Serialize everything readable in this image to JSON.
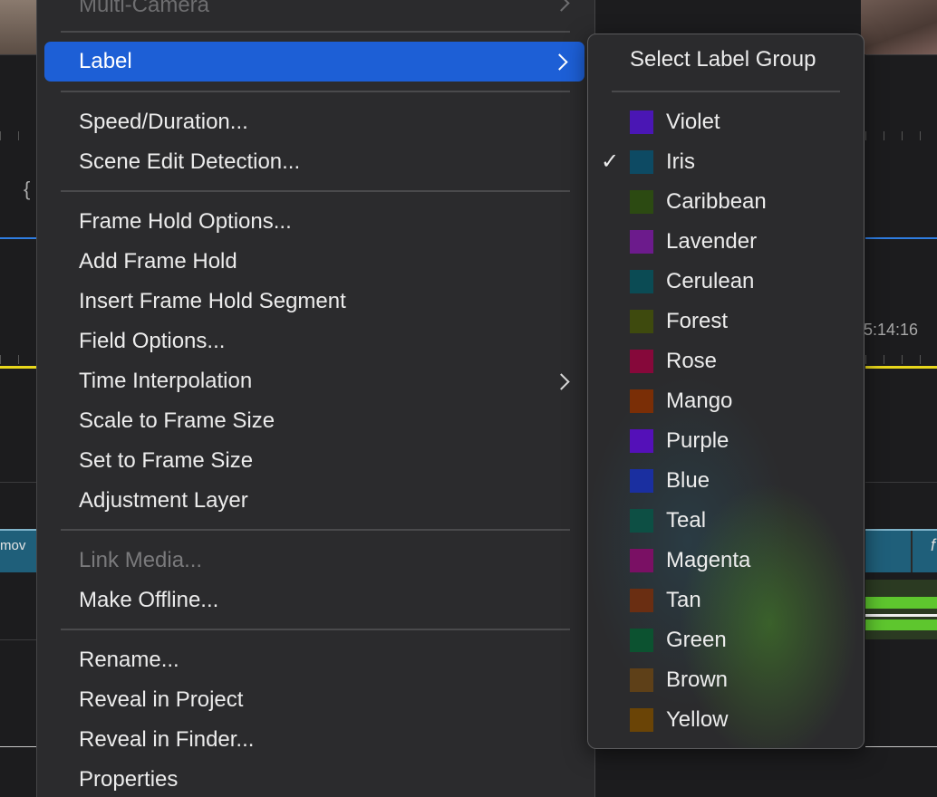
{
  "background": {
    "timecode": "5:14:16",
    "clip_left_label": "mov",
    "clip_right_label": "f",
    "brace": "{"
  },
  "menu": {
    "items": [
      {
        "label": "Multi-Camera",
        "state": "faded",
        "submenu": true
      },
      {
        "label": "Label",
        "state": "highlighted",
        "submenu": true
      },
      {
        "label": "Speed/Duration..."
      },
      {
        "label": "Scene Edit Detection..."
      },
      {
        "label": "Frame Hold Options..."
      },
      {
        "label": "Add Frame Hold"
      },
      {
        "label": "Insert Frame Hold Segment"
      },
      {
        "label": "Field Options..."
      },
      {
        "label": "Time Interpolation",
        "submenu": true
      },
      {
        "label": "Scale to Frame Size"
      },
      {
        "label": "Set to Frame Size"
      },
      {
        "label": "Adjustment Layer"
      },
      {
        "label": "Link Media...",
        "state": "disabled"
      },
      {
        "label": "Make Offline..."
      },
      {
        "label": "Rename..."
      },
      {
        "label": "Reveal in Project"
      },
      {
        "label": "Reveal in Finder..."
      },
      {
        "label": "Properties"
      }
    ],
    "highlight_color": "#1d5fd6"
  },
  "submenu": {
    "header": "Select Label Group",
    "checkmark": "✓",
    "checked_label": "Iris",
    "labels": [
      {
        "name": "Violet",
        "color": "#4a16b4"
      },
      {
        "name": "Iris",
        "color": "#0d4a63"
      },
      {
        "name": "Caribbean",
        "color": "#2c4a12"
      },
      {
        "name": "Lavender",
        "color": "#6c1b8c"
      },
      {
        "name": "Cerulean",
        "color": "#0b4b54"
      },
      {
        "name": "Forest",
        "color": "#3e4a0e"
      },
      {
        "name": "Rose",
        "color": "#86083a"
      },
      {
        "name": "Mango",
        "color": "#7a2e06"
      },
      {
        "name": "Purple",
        "color": "#5410b8"
      },
      {
        "name": "Blue",
        "color": "#1a2fa0"
      },
      {
        "name": "Teal",
        "color": "#0d4f44"
      },
      {
        "name": "Magenta",
        "color": "#7a1064"
      },
      {
        "name": "Tan",
        "color": "#6a2e12"
      },
      {
        "name": "Green",
        "color": "#0c5230"
      },
      {
        "name": "Brown",
        "color": "#5e4018"
      },
      {
        "name": "Yellow",
        "color": "#6a4406"
      }
    ]
  }
}
